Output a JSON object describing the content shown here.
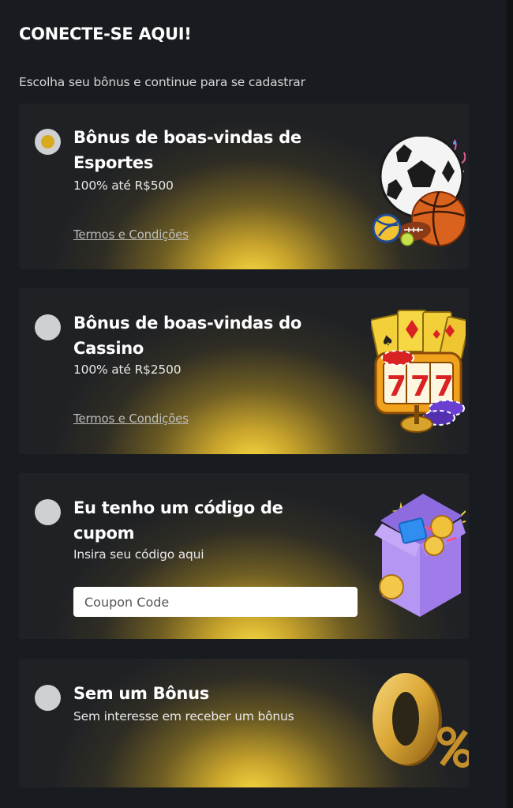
{
  "header": {
    "title": "CONECTE-SE AQUI!",
    "subtitle": "Escolha seu bônus e continue para se cadastrar"
  },
  "options": [
    {
      "title": "Bônus de boas-vindas de Esportes",
      "description": "100% até R$500",
      "terms": "Termos e Condições",
      "selected": true,
      "icon": "sports-balls-icon"
    },
    {
      "title": "Bônus de boas-vindas do Cassino",
      "description": "100% até R$2500",
      "terms": "Termos e Condições",
      "selected": false,
      "icon": "slot-machine-icon"
    },
    {
      "title": "Eu tenho um código de cupom",
      "description": "Insira seu código aqui",
      "input_placeholder": "Coupon Code",
      "selected": false,
      "icon": "gift-box-icon"
    },
    {
      "title": "Sem um Bônus",
      "description": "Sem interesse em receber um bônus",
      "selected": false,
      "icon": "zero-percent-icon"
    }
  ],
  "colors": {
    "background": "#181b1f",
    "card": "#1f2125",
    "accent": "#d9a91d",
    "glow": "#f3d640"
  }
}
